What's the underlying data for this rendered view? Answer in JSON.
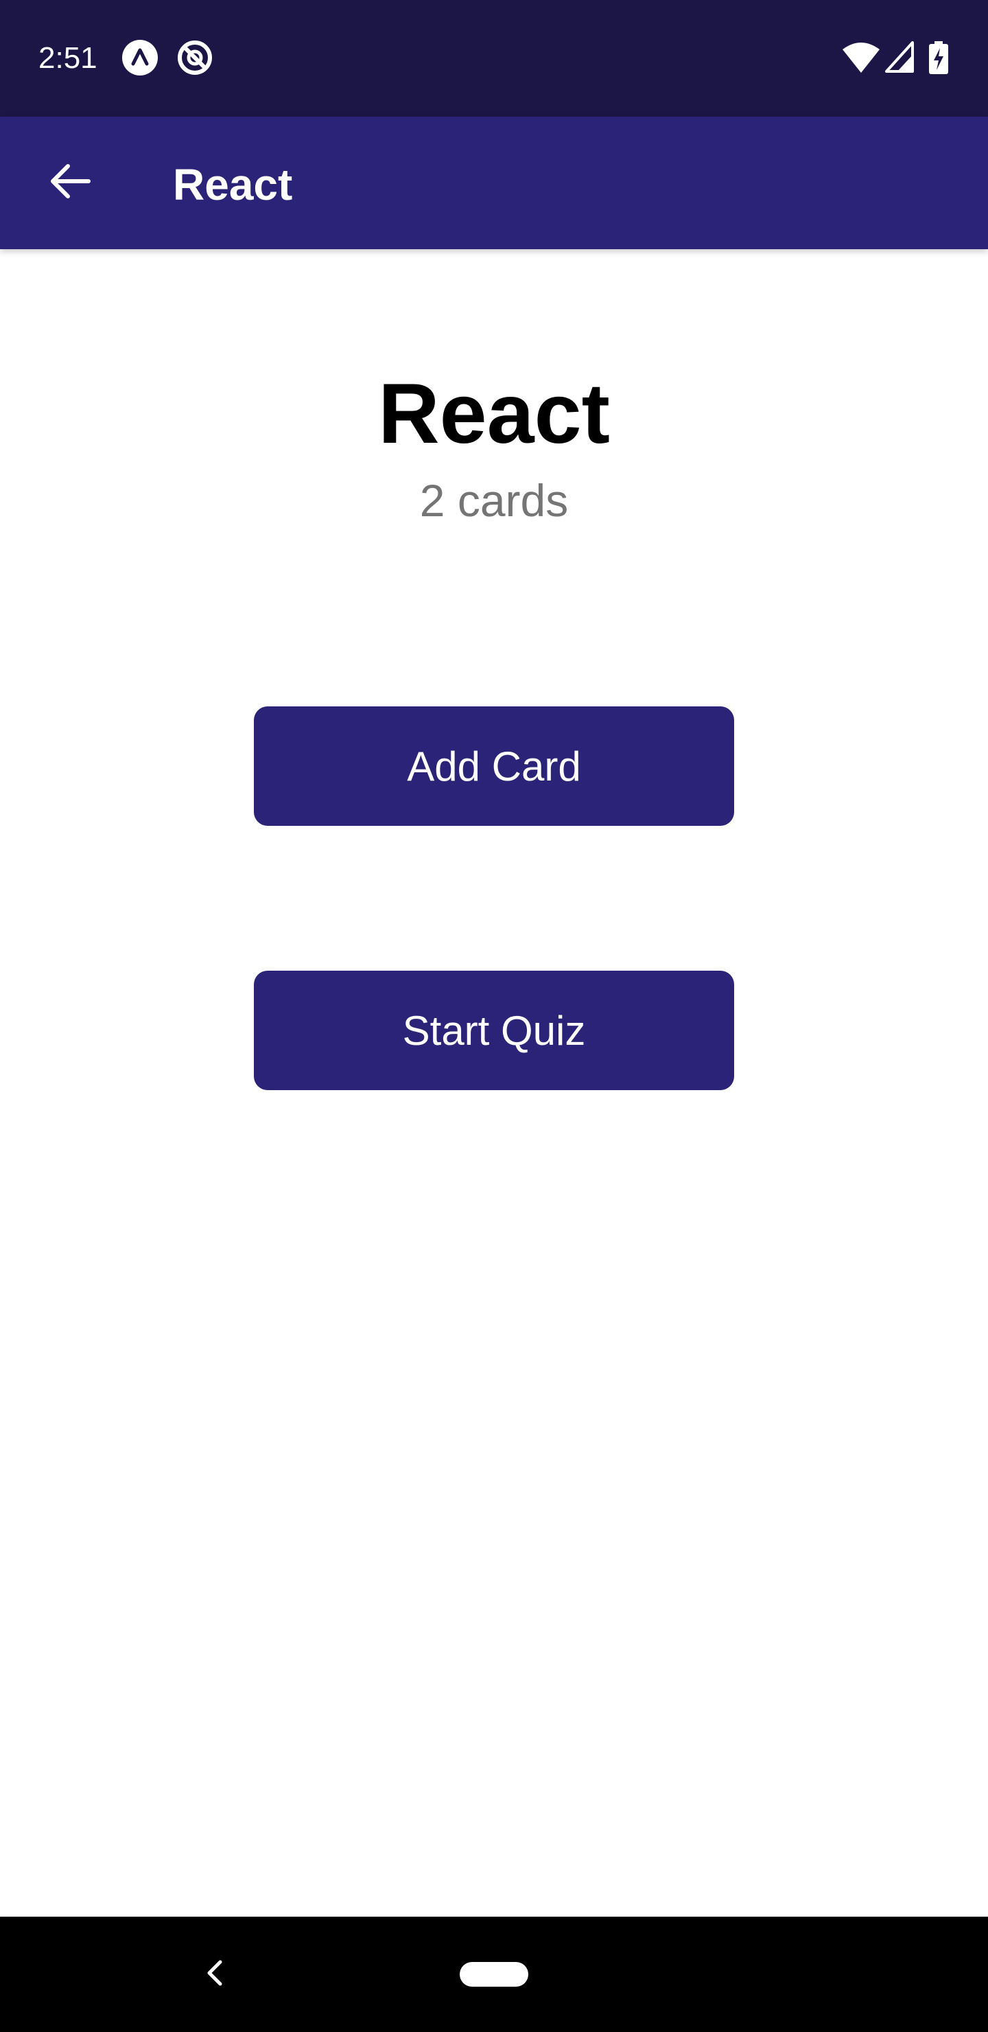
{
  "status_bar": {
    "time": "2:51",
    "icons_left": [
      "app-notification-icon",
      "do-not-disturb-icon"
    ],
    "icons_right": [
      "wifi-icon",
      "cellular-signal-icon",
      "battery-charging-icon"
    ]
  },
  "app_bar": {
    "back_icon": "arrow-back-icon",
    "title": "React"
  },
  "deck": {
    "title": "React",
    "card_count": "2 cards"
  },
  "actions": {
    "add_card_label": "Add Card",
    "start_quiz_label": "Start Quiz"
  },
  "nav_bar": {
    "back_icon": "nav-back-icon",
    "home_icon": "nav-home-pill-icon"
  },
  "colors": {
    "status_bar": "#1b1645",
    "primary": "#2a2378",
    "button_text": "#ffffff",
    "count_text": "#757575",
    "nav_bar": "#000000"
  }
}
